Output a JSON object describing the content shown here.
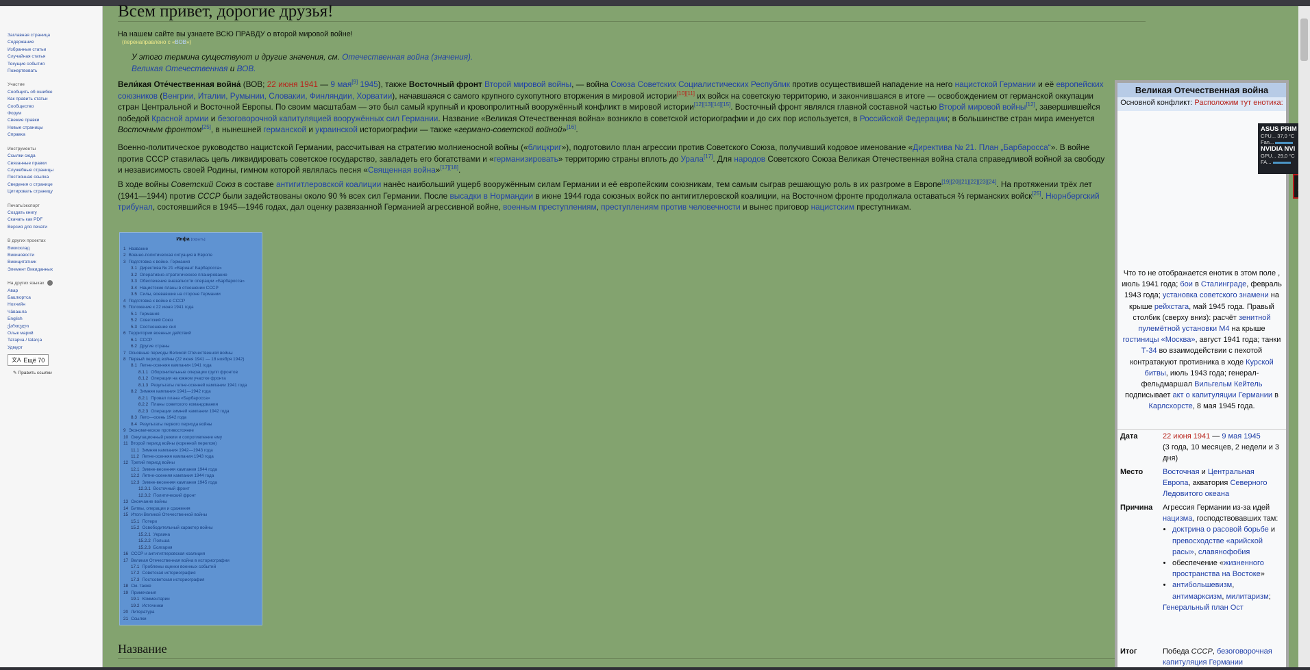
{
  "sidebar": {
    "nav": [
      "Заглавная страница",
      "Содержание",
      "Избранные статьи",
      "Случайная статья",
      "Текущие события",
      "Пожертвовать"
    ],
    "participation_title": "Участие",
    "participation": [
      "Сообщить об ошибке",
      "Как править статьи",
      "Сообщество",
      "Форум",
      "Свежие правки",
      "Новые страницы",
      "Справка"
    ],
    "tools_title": "Инструменты",
    "tools": [
      "Ссылки сюда",
      "Связанные правки",
      "Служебные страницы",
      "Постоянная ссылка",
      "Сведения о странице",
      "Цитировать страницу"
    ],
    "print_title": "Печать/экспорт",
    "print": [
      "Создать книгу",
      "Скачать как PDF",
      "Версия для печати"
    ],
    "projects_title": "В других проектах",
    "projects": [
      "Викисклад",
      "Викиновости",
      "Викицитатник",
      "Элемент Викиданных"
    ],
    "langs_title": "На других языках",
    "langs": [
      "Авар",
      "Башҡортса",
      "Нохчийн",
      "Чӑвашла",
      "English",
      "ქართული",
      "Олык марий",
      "Татарча / tatarça",
      "Удмурт"
    ],
    "more_langs": "Ещё 70",
    "edit_links": "Править ссылки"
  },
  "article": {
    "title": "Всем привет, дорогие друзья!",
    "intro": "На нашем сайте вы узнаете ВСЮ ПРАВДУ о второй мировой войне!",
    "redirect_pre": "(перенаправлено с «",
    "redirect_link": "ВОВ",
    "redirect_post": "»)",
    "hatnote_pre": "У этого термина существуют и другие значения, см. ",
    "hatnote_link1": "Отечественная война (значения).",
    "hatnote_link2": "Великая Отечественная",
    "hatnote_and": " и ",
    "hatnote_link3": "ВОВ.",
    "p1": {
      "bold1": "Вели́кая Оте́чественная война́",
      "t1": " (ВОВ; ",
      "date1": "22 июня 1941",
      "t2": " — ",
      "date2": "9 мая",
      "ref1": "[9]",
      "date3": "1945",
      "t3": "), также ",
      "bold2": "Восточный фронт",
      "t4": " ",
      "link1": "Второй мировой войны",
      "t5": ", — война ",
      "link2": "Союза Советских Социалистических Республик",
      "t6": " против осуществившей нападение на него ",
      "link3": "нацистской Германии",
      "t7": " и её ",
      "link4": "европейских союзников",
      "t8": " (",
      "link5": "Венгрии, Италии, Румынии, Словакии, Финляндии, Хорватии",
      "t9": "), начавшаяся с самого крупного сухопутного вторжения в мировой истории",
      "ref2": "[10][11]",
      "t10": " их войск на советскую территорию, и закончившаяся в итоге — освобождением от германской оккупации стран Центральной и Восточной Европы. По своим масштабам — это был самый крупный и кровопролитный вооружённый конфликт в мировой истории",
      "ref3": "[12][13][14][15]",
      "t11": ". Восточный фронт являлся главной составной частью ",
      "link6": "Второй мировой войны",
      "ref4": "[12]",
      "t12": ", завершившейся победой ",
      "link7": "Красной армии",
      "t13": " и ",
      "link8": "безоговорочной капитуляцией вооружённых сил Германии",
      "t14": ". Название «Великая Отечественная война» возникло в советской историографии и до сих пор используется, в ",
      "link9": "Российской Федерации",
      "t15": "; в большинстве стран мира именуется ",
      "ital1": "Восточным фронтом",
      "ref5": "[25]",
      "t16": ", в нынешней ",
      "link10": "германской",
      "t17": " и ",
      "link11": "украинской",
      "t18": " историографии — также «",
      "ital2": "германо-советской войной",
      "t19": "»",
      "ref6": "[16]",
      "t20": "."
    },
    "p2": {
      "t1": "Военно-политическое руководство нацистской Германии, рассчитывая на стратегию молниеносной войны («",
      "link1": "блицкриг",
      "t2": "»), подготовило план агрессии против Советского Союза, получивший кодовое именование «",
      "link2": "Директива № 21. План „Барбаросса“",
      "t3": "». В войне против СССР ставилась цель ликвидировать советское государство, завладеть его богатствами и «",
      "link3": "германизировать",
      "t4": "» территорию страны вплоть до ",
      "link4": "Урала",
      "ref1": "[17]",
      "t5": ". Для ",
      "link5": "народов",
      "t6": " Советского Союза Великая Отечественная война стала справедливой войной за свободу и независимость своей Родины, гимном которой являлась песня «",
      "link6": "Священная война",
      "t7": "»",
      "ref2": "[17][18]",
      "t8": "."
    },
    "p3": {
      "t1": "В ходе войны ",
      "ital1": "Советский Союз",
      "t2": " в составе ",
      "link1": "антигитлеровской коалиции",
      "t3": " нанёс наибольший ущерб вооружённым силам Германии и её европейским союзникам, тем самым сыграв решающую роль в их разгроме в Европе",
      "ref1": "[19][20][21][22][23][24]",
      "t4": ". На протяжении трёх лет (1941—1944) против ",
      "ital2": "СССР",
      "t5": " были задействованы около 90 % всех сил Германии. После ",
      "link2": "высадки в Нормандии",
      "t6": " в июне 1944 года союзных войск по антигитлеровской коалиции, на Восточном фронте продолжала оставаться ⅔ германских войск",
      "ref2": "[25]",
      "t7": ". ",
      "link3": "Нюрнбергский трибунал",
      "t8": ", состоявшийся в 1945—1946 годах, дал оценку развязанной Германией агрессивной войне, ",
      "link4": "военным преступлениям",
      "t9": ", ",
      "link5": "преступлениям против человечности",
      "t10": " и вынес приговор ",
      "link6": "нацистским",
      "t11": " преступникам."
    },
    "section2": "Название"
  },
  "toc": {
    "title": "Инфа",
    "hide": "[скрыть]",
    "items": [
      {
        "n": "1",
        "t": "Название",
        "lv": 0
      },
      {
        "n": "2",
        "t": "Военно-политическая ситуация в Европе",
        "lv": 0
      },
      {
        "n": "3",
        "t": "Подготовка к войне. Германия",
        "lv": 0
      },
      {
        "n": "3.1",
        "t": "Директива № 21 «Вариант Барбаросса»",
        "lv": 1
      },
      {
        "n": "3.2",
        "t": "Оперативно-стратегическое планирование",
        "lv": 1
      },
      {
        "n": "3.3",
        "t": "Обеспечение внезапности операции «Барбаросса»",
        "lv": 1
      },
      {
        "n": "3.4",
        "t": "Нацистские планы в отношении СССР",
        "lv": 1
      },
      {
        "n": "3.5",
        "t": "Силы, воевавшие на стороне Германии",
        "lv": 1
      },
      {
        "n": "4",
        "t": "Подготовка к войне в СССР",
        "lv": 0
      },
      {
        "n": "5",
        "t": "Положение к 22 июня 1941 года",
        "lv": 0
      },
      {
        "n": "5.1",
        "t": "Германия",
        "lv": 1
      },
      {
        "n": "5.2",
        "t": "Советский Союз",
        "lv": 1
      },
      {
        "n": "5.3",
        "t": "Соотношение сил",
        "lv": 1
      },
      {
        "n": "6",
        "t": "Территории военных действий",
        "lv": 0
      },
      {
        "n": "6.1",
        "t": "СССР",
        "lv": 1
      },
      {
        "n": "6.2",
        "t": "Другие страны",
        "lv": 1
      },
      {
        "n": "7",
        "t": "Основные периоды Великой Отечественной войны",
        "lv": 0
      },
      {
        "n": "8",
        "t": "Первый период войны (22 июня 1941 — 18 ноября 1942)",
        "lv": 0
      },
      {
        "n": "8.1",
        "t": "Летне-осенняя кампания 1941 года",
        "lv": 1
      },
      {
        "n": "8.1.1",
        "t": "Оборонительные операции групп фронтов",
        "lv": 2
      },
      {
        "n": "8.1.2",
        "t": "Операции на южном участке фронта",
        "lv": 2
      },
      {
        "n": "8.1.3",
        "t": "Результаты летне-осенней кампании 1941 года",
        "lv": 2
      },
      {
        "n": "8.2",
        "t": "Зимняя кампания 1941—1942 года",
        "lv": 1
      },
      {
        "n": "8.2.1",
        "t": "Провал плана «Барбаросса»",
        "lv": 2
      },
      {
        "n": "8.2.2",
        "t": "Планы советского командования",
        "lv": 2
      },
      {
        "n": "8.2.3",
        "t": "Операции зимней кампании 1942 года",
        "lv": 2
      },
      {
        "n": "8.3",
        "t": "Лето—осень 1942 года",
        "lv": 1
      },
      {
        "n": "8.4",
        "t": "Результаты первого периода войны",
        "lv": 1
      },
      {
        "n": "9",
        "t": "Экономическое противостояние",
        "lv": 0
      },
      {
        "n": "10",
        "t": "Оккупационный режим и сопротивление ему",
        "lv": 0
      },
      {
        "n": "11",
        "t": "Второй период войны (коренной перелом)",
        "lv": 0
      },
      {
        "n": "11.1",
        "t": "Зимняя кампания 1942—1943 года",
        "lv": 1
      },
      {
        "n": "11.2",
        "t": "Летне-осенняя кампания 1943 года",
        "lv": 1
      },
      {
        "n": "12",
        "t": "Третий период войны",
        "lv": 0
      },
      {
        "n": "12.1",
        "t": "Зимне-весенняя кампания 1944 года",
        "lv": 1
      },
      {
        "n": "12.2",
        "t": "Летне-осенняя кампания 1944 года",
        "lv": 1
      },
      {
        "n": "12.3",
        "t": "Зимне-весенняя кампания 1945 года",
        "lv": 1
      },
      {
        "n": "12.3.1",
        "t": "Восточный фронт",
        "lv": 2
      },
      {
        "n": "12.3.2",
        "t": "Политический фронт",
        "lv": 2
      },
      {
        "n": "13",
        "t": "Окончание войны",
        "lv": 0
      },
      {
        "n": "14",
        "t": "Битвы, операции и сражения",
        "lv": 0
      },
      {
        "n": "15",
        "t": "Итоги Великой Отечественной войны",
        "lv": 0
      },
      {
        "n": "15.1",
        "t": "Потери",
        "lv": 1
      },
      {
        "n": "15.2",
        "t": "Освободительный характер войны",
        "lv": 1
      },
      {
        "n": "15.2.1",
        "t": "Украина",
        "lv": 2
      },
      {
        "n": "15.2.2",
        "t": "Польша",
        "lv": 2
      },
      {
        "n": "15.2.3",
        "t": "Болгария",
        "lv": 2
      },
      {
        "n": "16",
        "t": "СССР и антигитлеровская коалиция",
        "lv": 0
      },
      {
        "n": "17",
        "t": "Великая Отечественная война в историографии",
        "lv": 0
      },
      {
        "n": "17.1",
        "t": "Проблемы оценки военных событий",
        "lv": 1
      },
      {
        "n": "17.2",
        "t": "Советская историография",
        "lv": 1
      },
      {
        "n": "17.3",
        "t": "Постсоветская историография",
        "lv": 1
      },
      {
        "n": "18",
        "t": "См. также",
        "lv": 0
      },
      {
        "n": "19",
        "t": "Примечания",
        "lv": 0
      },
      {
        "n": "19.1",
        "t": "Комментарии",
        "lv": 1
      },
      {
        "n": "19.2",
        "t": "Источники",
        "lv": 1
      },
      {
        "n": "20",
        "t": "Литература",
        "lv": 0
      },
      {
        "n": "21",
        "t": "Ссылки",
        "lv": 0
      }
    ]
  },
  "infobox": {
    "title": "Великая Отечественная война",
    "conflict_label": "Основной конфликт: ",
    "conflict_value": "Расположим тут енотика:",
    "caption_t1": "Что то не отображается енотик в этом поле , июль 1941 года; ",
    "caption_l1": "бои",
    "caption_t2": " в ",
    "caption_l2": "Сталинграде",
    "caption_t3": ", февраль 1943 года; ",
    "caption_l3": "установка советского знамени",
    "caption_t4": " на крыше ",
    "caption_l4": "рейхстага",
    "caption_t5": ", май 1945 года. Правый столбик (сверху вниз): расчёт ",
    "caption_l5": "зенитной пулемётной установки М4",
    "caption_t6": " на крыше ",
    "caption_l6": "гостиницы «Москва»",
    "caption_t7": ", август 1941 года; танки ",
    "caption_l7": "Т-34",
    "caption_t8": " во взаимодействии с пехотой контратакуют противника в ходе ",
    "caption_l8": "Курской битвы",
    "caption_t9": ", июль 1943 года; генерал-фельдмаршал ",
    "caption_l9": "Вильгельм Кейтель",
    "caption_t10": " подписывает ",
    "caption_l10": "акт о капитуляции Германии",
    "caption_t11": " в ",
    "caption_l11": "Карлсхорсте",
    "caption_t12": ", 8 мая 1945 года.",
    "date_label": "Дата",
    "date_start": "22 июня 1941",
    "date_sep": " — ",
    "date_end": "9 мая 1945",
    "date_dur": "(3 года, 10 месяцев, 2 недели и 3 дня)",
    "place_label": "Место",
    "place_l1": "Восточная",
    "place_t1": " и ",
    "place_l2": "Центральная Европа",
    "place_t2": ", акватория ",
    "place_l3": "Северного Ледовитого океана",
    "cause_label": "Причина",
    "cause_t1": "Агрессия Германии из-за идей ",
    "cause_l1": "нацизма",
    "cause_t2": ", господствовавших там:",
    "cause_b1_l1": "доктрина о расовой борьбе",
    "cause_b1_t1": " и ",
    "cause_b1_l2": "превосходстве «арийской расы»",
    "cause_b1_t2": ", ",
    "cause_b1_l3": "славянофобия",
    "cause_b2_t1": "обеспечение «",
    "cause_b2_l1": "жизненного пространства на Востоке",
    "cause_b2_t2": "»",
    "cause_b3_l1": "антибольшевизм",
    "cause_b3_t1": ", ",
    "cause_b3_l2": "антимарксизм",
    "cause_b3_t2": ", ",
    "cause_b3_l3": "милитаризм",
    "cause_b3_t3": ";",
    "cause_l2": "Генеральный план Ост",
    "result_label": "Итог",
    "result_t1": "Победа ",
    "result_i1": "СССР",
    "result_t2": ", ",
    "result_l1": "безоговорочная капитуляция Германии"
  },
  "widget": {
    "gpu1": "ASUS PRIM",
    "cpu1": "CPU...",
    "temp1": "37,0 °C",
    "fan1": "Fan...",
    "gpu2": "NVIDIA NVI",
    "gpu_label": "GPU...",
    "temp2": "29,0 °C",
    "fan2": "FA...",
    "alert": "1"
  },
  "colors": {
    "content_bg": "#83a36f",
    "toc_bg": "#5f93d2",
    "link": "#1f3fa8",
    "date_red": "#b8231b"
  }
}
